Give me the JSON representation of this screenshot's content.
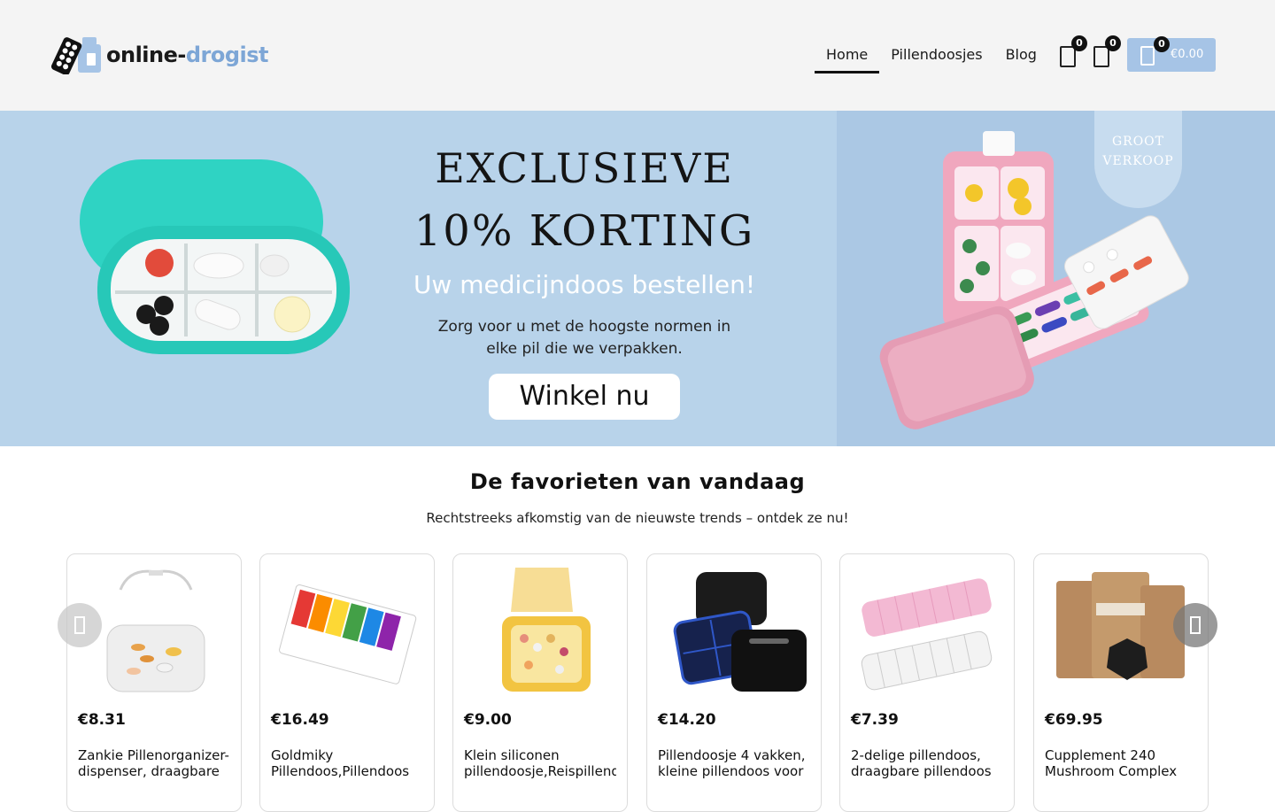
{
  "header": {
    "logo": {
      "text_part1": "online-",
      "text_part2": "drogist"
    },
    "nav": [
      {
        "label": "Home",
        "active": true
      },
      {
        "label": "Pillendoosjes",
        "active": false
      },
      {
        "label": "Blog",
        "active": false
      }
    ],
    "wishlist": {
      "icon": "heart-icon",
      "count": "0"
    },
    "compare": {
      "icon": "bag-icon",
      "count": "0"
    },
    "cart": {
      "icon": "cart-icon",
      "count": "0",
      "total": "€0.00"
    }
  },
  "hero": {
    "title_line1": "EXCLUSIEVE",
    "title_line2": "10% KORTING",
    "subtitle": "Uw medicijndoos bestellen!",
    "description_line1": "Zorg voor u met de hoogste normen in",
    "description_line2": "elke pil die we verpakken.",
    "cta": "Winkel nu",
    "badge_line1": "GROOT",
    "badge_line2": "VERKOOP"
  },
  "section": {
    "title": "De favorieten van vandaag",
    "subtitle": "Rechtstreeks afkomstig van de nieuwste trends – ontdek ze nu!"
  },
  "products": [
    {
      "price": "€8.31",
      "title_line1": "Zankie Pillenorganizer-",
      "title_line2": "dispenser, draagbare"
    },
    {
      "price": "€16.49",
      "title_line1": "Goldmiky",
      "title_line2": "Pillendoos,Pillendoos"
    },
    {
      "price": "€9.00",
      "title_line1": "Klein siliconen",
      "title_line2": "pillendoosje,Reispillendoos"
    },
    {
      "price": "€14.20",
      "title_line1": "Pillendoosje 4 vakken,",
      "title_line2": "kleine pillendoos voor"
    },
    {
      "price": "€7.39",
      "title_line1": "2-delige pillendoos,",
      "title_line2": "draagbare pillendoos"
    },
    {
      "price": "€69.95",
      "title_line1": "Cupplement 240",
      "title_line2": "Mushroom Complex"
    }
  ],
  "carousel": {
    "prev_icon": "chevron-left-icon",
    "next_icon": "chevron-right-icon"
  },
  "colors": {
    "accent": "#7da6d6",
    "cart_button": "#a6c4e6",
    "hero_bg": "#b8d3ea"
  }
}
